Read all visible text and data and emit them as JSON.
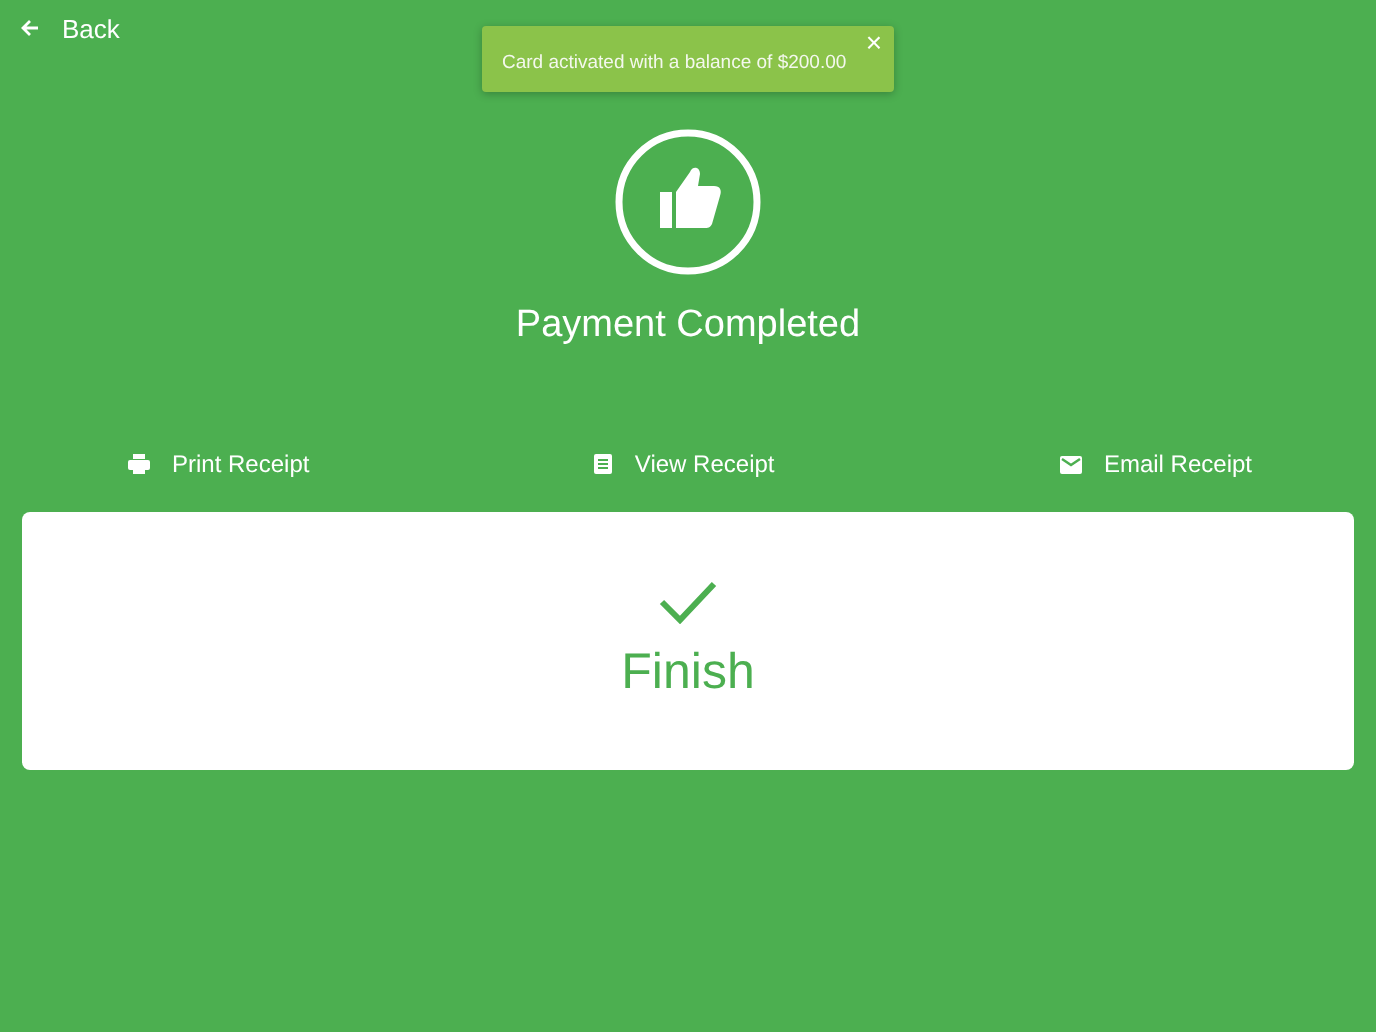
{
  "back": {
    "label": "Back"
  },
  "toast": {
    "message": "Card activated with a balance of $200.00",
    "close": "×"
  },
  "status": {
    "title": "Payment Completed"
  },
  "actions": [
    {
      "kind": "print",
      "label": "Print Receipt"
    },
    {
      "kind": "view",
      "label": "View Receipt"
    },
    {
      "kind": "email",
      "label": "Email Receipt"
    }
  ],
  "finish": {
    "label": "Finish"
  }
}
